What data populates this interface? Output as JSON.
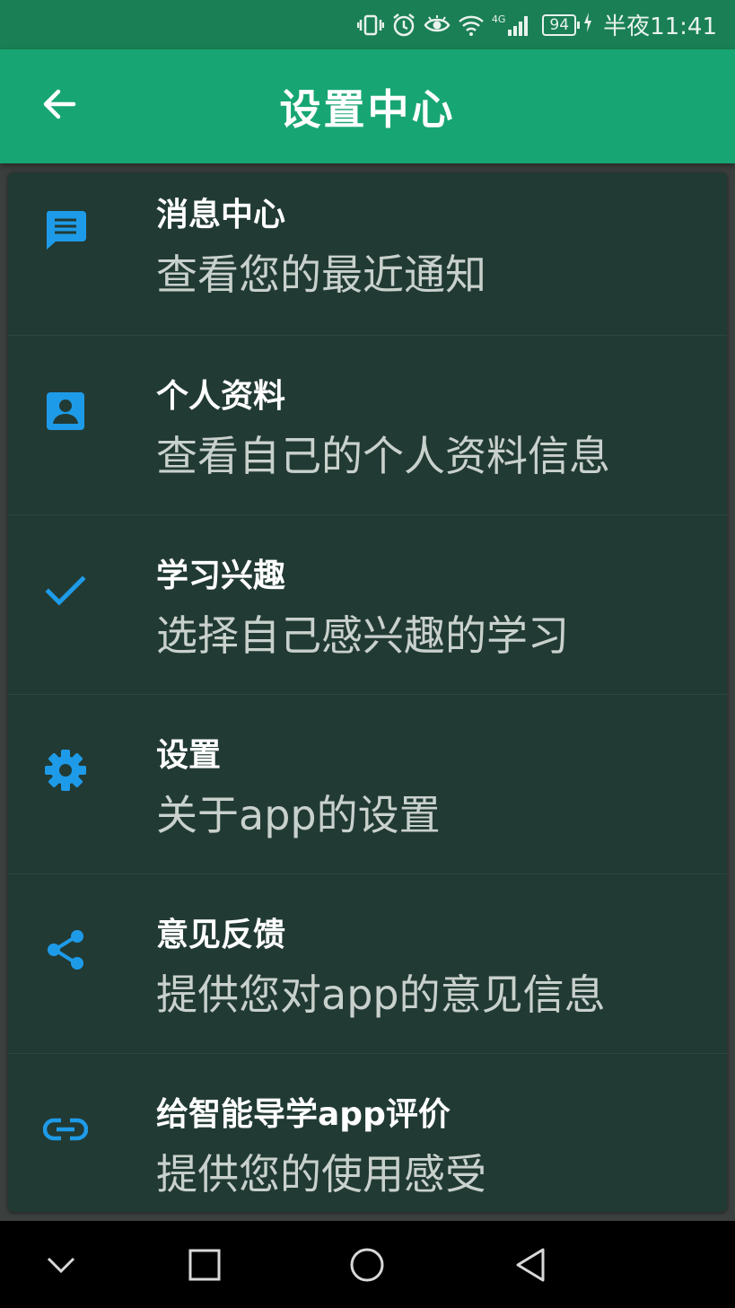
{
  "status_bar": {
    "network": "4G",
    "battery": "94",
    "time": "半夜11:41"
  },
  "app_bar": {
    "title": "设置中心",
    "back_icon": "arrow-back-icon"
  },
  "accent_color": "#1e9be8",
  "menu": [
    {
      "icon": "message-icon",
      "title": "消息中心",
      "subtitle": "查看您的最近通知"
    },
    {
      "icon": "profile-card-icon",
      "title": "个人资料",
      "subtitle": "查看自己的个人资料信息"
    },
    {
      "icon": "check-icon",
      "title": "学习兴趣",
      "subtitle": "选择自己感兴趣的学习"
    },
    {
      "icon": "gear-icon",
      "title": "设置",
      "subtitle": "关于app的设置"
    },
    {
      "icon": "share-icon",
      "title": "意见反馈",
      "subtitle": "提供您对app的意见信息"
    },
    {
      "icon": "link-icon",
      "title": "给智能导学app评价",
      "subtitle": "提供您的使用感受"
    }
  ],
  "nav_bar": {
    "items": [
      "chevron-down-icon",
      "square-recents-icon",
      "circle-home-icon",
      "triangle-back-icon"
    ]
  }
}
